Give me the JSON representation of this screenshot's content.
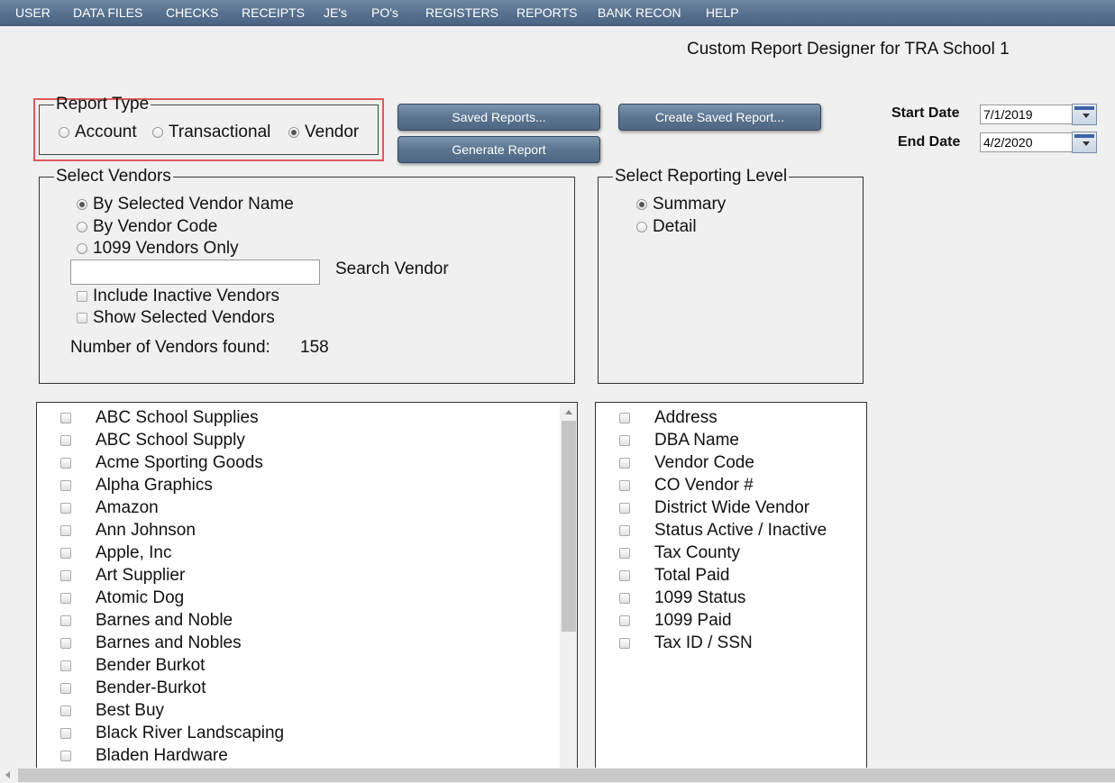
{
  "menu": [
    "USER",
    "DATA FILES",
    "CHECKS",
    "RECEIPTS",
    "JE's",
    "PO's",
    "REGISTERS",
    "REPORTS",
    "BANK RECON",
    "HELP"
  ],
  "page_title": "Custom Report Designer for TRA School 1",
  "report_type": {
    "legend": "Report Type",
    "options": [
      "Account",
      "Transactional",
      "Vendor"
    ],
    "selected": "Vendor",
    "highlight_color": "#e05a5a"
  },
  "buttons": {
    "saved_reports": "Saved Reports...",
    "generate_report": "Generate Report",
    "create_saved_report": "Create Saved Report..."
  },
  "dates": {
    "start_label": "Start Date",
    "start_value": "7/1/2019",
    "end_label": "End Date",
    "end_value": "4/2/2020"
  },
  "select_vendors": {
    "legend": "Select Vendors",
    "options": [
      "By Selected Vendor Name",
      "By Vendor Code",
      "1099 Vendors Only"
    ],
    "selected": "By Selected Vendor Name",
    "search_label": "Search Vendor",
    "search_value": "",
    "include_inactive": "Include Inactive Vendors",
    "show_selected": "Show Selected Vendors",
    "count_label": "Number of Vendors found:",
    "count_value": "158"
  },
  "reporting_level": {
    "legend": "Select Reporting Level",
    "options": [
      "Summary",
      "Detail"
    ],
    "selected": "Summary"
  },
  "vendors": [
    "ABC School Supplies",
    "ABC School Supply",
    "Acme Sporting Goods",
    "Alpha Graphics",
    "Amazon",
    "Ann Johnson",
    "Apple, Inc",
    "Art Supplier",
    "Atomic Dog",
    "Barnes and Noble",
    "Barnes and Nobles",
    "Bender Burkot",
    "Bender-Burkot",
    "Best Buy",
    "Black River Landscaping",
    "Bladen Hardware"
  ],
  "fields": [
    "Address",
    "DBA Name",
    "Vendor Code",
    "CO Vendor #",
    "District Wide Vendor",
    "Status Active / Inactive",
    "Tax County",
    "Total Paid",
    "1099 Status",
    "1099 Paid",
    "Tax ID / SSN"
  ]
}
